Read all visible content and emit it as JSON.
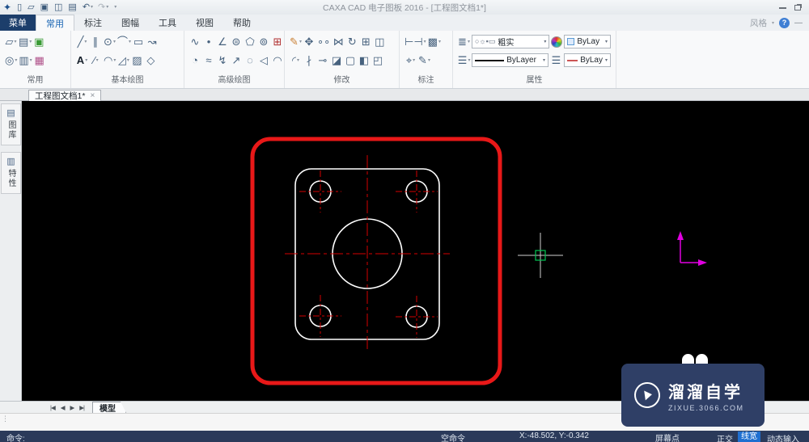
{
  "title_bar": {
    "title": "CAXA CAD 电子图板 2016 - [工程图文档1*]",
    "quick_access": [
      {
        "name": "app-logo-icon",
        "glyph": "✦",
        "cls": "blue"
      },
      {
        "name": "new-file-icon",
        "glyph": "▯",
        "caret": ""
      },
      {
        "name": "open-file-icon",
        "glyph": "▱",
        "caret": ""
      },
      {
        "name": "save-icon",
        "glyph": "▣",
        "caret": ""
      },
      {
        "name": "save-all-icon",
        "glyph": "◫",
        "caret": ""
      },
      {
        "name": "print-icon",
        "glyph": "▤",
        "caret": ""
      },
      {
        "name": "undo-icon",
        "glyph": "↶",
        "caret": "▾"
      },
      {
        "name": "redo-icon",
        "glyph": "↷",
        "caret": "▾",
        "cls": "dim"
      },
      {
        "name": "customize-quick-access-icon",
        "glyph": "",
        "caret": "▾"
      }
    ],
    "style_label": "风格",
    "help_label": "?"
  },
  "ribbon": {
    "tabs": [
      {
        "label": "菜单",
        "name": "tab-menu",
        "cls": "menu"
      },
      {
        "label": "常用",
        "name": "tab-common",
        "cls": "active"
      },
      {
        "label": "标注",
        "name": "tab-dimension",
        "cls": ""
      },
      {
        "label": "图幅",
        "name": "tab-sheet",
        "cls": ""
      },
      {
        "label": "工具",
        "name": "tab-tools",
        "cls": ""
      },
      {
        "label": "视图",
        "name": "tab-view",
        "cls": ""
      },
      {
        "label": "帮助",
        "name": "tab-help",
        "cls": ""
      }
    ],
    "groups": [
      {
        "label": "常用",
        "row1": [
          {
            "name": "copy-icon",
            "glyph": "▱",
            "caret": "▾"
          },
          {
            "name": "paste-icon",
            "glyph": "▤",
            "caret": "▾"
          },
          {
            "name": "ole-insert-icon",
            "glyph": "▣",
            "caret": "",
            "cls": "green"
          }
        ],
        "row2": [
          {
            "name": "zoom-icon",
            "glyph": "◎",
            "caret": "▾"
          },
          {
            "name": "view-pan-icon",
            "glyph": "▥",
            "caret": "▾"
          },
          {
            "name": "palette-icon",
            "glyph": "▦",
            "caret": "",
            "cls": "multi"
          }
        ]
      },
      {
        "label": "基本绘图",
        "row1": [
          {
            "name": "line-icon",
            "glyph": "╱",
            "caret": "▾"
          },
          {
            "name": "parallel-line-icon",
            "glyph": "∥",
            "caret": ""
          },
          {
            "name": "circle-icon",
            "glyph": "⊙",
            "caret": "▾"
          },
          {
            "name": "arc-icon",
            "glyph": "⌒",
            "caret": "▾"
          },
          {
            "name": "rectangle-icon",
            "glyph": "▭",
            "caret": ""
          },
          {
            "name": "polyline-icon",
            "glyph": "↝",
            "caret": ""
          }
        ],
        "row2": [
          {
            "name": "text-icon",
            "glyph": "A",
            "caret": "▾",
            "cls": "dark"
          },
          {
            "name": "centerline-icon",
            "glyph": "∕",
            "caret": "▾"
          },
          {
            "name": "revision-cloud-icon",
            "glyph": "◠",
            "caret": "▾"
          },
          {
            "name": "chamfer-icon",
            "glyph": "◿",
            "caret": "▾"
          },
          {
            "name": "hatch-icon",
            "glyph": "▨",
            "caret": ""
          },
          {
            "name": "local-detail-icon",
            "glyph": "◇",
            "caret": ""
          }
        ]
      },
      {
        "label": "高级绘图",
        "row1": [
          {
            "name": "spline-icon",
            "glyph": "∿",
            "caret": ""
          },
          {
            "name": "point-icon",
            "glyph": "•",
            "caret": ""
          },
          {
            "name": "angle-line-icon",
            "glyph": "∠",
            "caret": ""
          },
          {
            "name": "ellipse-icon",
            "glyph": "⊜",
            "caret": ""
          },
          {
            "name": "polygon-icon",
            "glyph": "⬠",
            "caret": ""
          },
          {
            "name": "symmetry-icon",
            "glyph": "⊚",
            "caret": ""
          },
          {
            "name": "table-icon",
            "glyph": "⊞",
            "caret": "",
            "cls": "redplus"
          }
        ],
        "row2": [
          {
            "name": "pie-icon",
            "glyph": "◔",
            "caret": ""
          },
          {
            "name": "wave-line-icon",
            "glyph": "≈",
            "caret": ""
          },
          {
            "name": "break-line-icon",
            "glyph": "↯",
            "caret": ""
          },
          {
            "name": "arrow-icon",
            "glyph": "↗",
            "caret": ""
          },
          {
            "name": "contour-icon",
            "glyph": "◌",
            "caret": ""
          },
          {
            "name": "formula-icon",
            "glyph": "◁",
            "caret": ""
          },
          {
            "name": "cloud-icon",
            "glyph": "◠",
            "caret": ""
          }
        ]
      },
      {
        "label": "修改",
        "row1": [
          {
            "name": "erase-icon",
            "glyph": "✎",
            "caret": "▾",
            "cls": "orange"
          },
          {
            "name": "move-icon",
            "glyph": "✥",
            "caret": ""
          },
          {
            "name": "copy-object-icon",
            "glyph": "∘∘",
            "caret": ""
          },
          {
            "name": "mirror-icon",
            "glyph": "⋈",
            "caret": ""
          },
          {
            "name": "rotate-icon",
            "glyph": "↻",
            "caret": ""
          },
          {
            "name": "array-icon",
            "glyph": "⊞",
            "caret": ""
          },
          {
            "name": "offset-icon",
            "glyph": "◫",
            "caret": ""
          }
        ],
        "row2": [
          {
            "name": "fillet-icon",
            "glyph": "◜",
            "caret": "▾"
          },
          {
            "name": "break-icon",
            "glyph": "∤",
            "caret": ""
          },
          {
            "name": "extend-icon",
            "glyph": "⊸",
            "caret": ""
          },
          {
            "name": "stretch-icon",
            "glyph": "◪",
            "caret": ""
          },
          {
            "name": "scale-icon",
            "glyph": "▢",
            "caret": ""
          },
          {
            "name": "block-icon",
            "glyph": "◧",
            "caret": ""
          },
          {
            "name": "explode-icon",
            "glyph": "◰",
            "caret": ""
          }
        ]
      },
      {
        "label": "标注",
        "row1": [
          {
            "name": "dimension-icon",
            "glyph": "⊢⊣",
            "caret": "▾"
          },
          {
            "name": "image-frame-icon",
            "glyph": "▩",
            "caret": "▾"
          }
        ],
        "row2": [
          {
            "name": "coordinate-dimension-icon",
            "glyph": "⌖",
            "caret": "▾"
          },
          {
            "name": "dimension-edit-icon",
            "glyph": "✎",
            "caret": "▾"
          }
        ]
      }
    ],
    "properties_group": {
      "label": "属性",
      "layers_glyph": "≣",
      "layer_state_icons": "○☼▪▭",
      "line_style_value": "粗实",
      "color_value": "ByLay",
      "linetype_glyph": "☰",
      "linetype_value": "ByLayer",
      "lineweight_value": "ByLay"
    }
  },
  "document": {
    "tab_label": "工程图文档1*",
    "close_glyph": "×"
  },
  "sidebar": {
    "tabs": [
      {
        "name": "sidebar-tab-library",
        "icon_name": "library-icon",
        "icon": "▤",
        "label": "图库"
      },
      {
        "name": "sidebar-tab-properties",
        "icon_name": "properties-icon",
        "icon": "▥",
        "label": "特性"
      }
    ]
  },
  "canvas": {
    "colors": {
      "outline": "#e81818",
      "geometry": "#ffffff",
      "centerline": "#d40000",
      "crosshair": "#cfcfcf",
      "pickbox": "#00c853",
      "ucs": "#e100e1"
    }
  },
  "model_bar": {
    "nav": [
      {
        "name": "first-sheet-button",
        "glyph": "|◀"
      },
      {
        "name": "prev-sheet-button",
        "glyph": "◀"
      },
      {
        "name": "next-sheet-button",
        "glyph": "▶"
      },
      {
        "name": "last-sheet-button",
        "glyph": "▶|"
      }
    ],
    "tab_label": "模型"
  },
  "status_bar": {
    "prompt": "命令:",
    "idle_command": "空命令",
    "coordinates": "X:-48.502, Y:-0.342",
    "screen_point": "屏幕点",
    "toggles": [
      {
        "label": "正交",
        "name": "ortho-toggle",
        "cls": "st-item-0"
      },
      {
        "label": "线宽",
        "name": "lineweight-toggle",
        "cls": "st-item-1"
      },
      {
        "label": "动态输入",
        "name": "dynamic-input-toggle",
        "cls": "st-item-2"
      }
    ]
  },
  "watermark": {
    "brand": "溜溜自学",
    "url": "zixue.3066.com"
  }
}
